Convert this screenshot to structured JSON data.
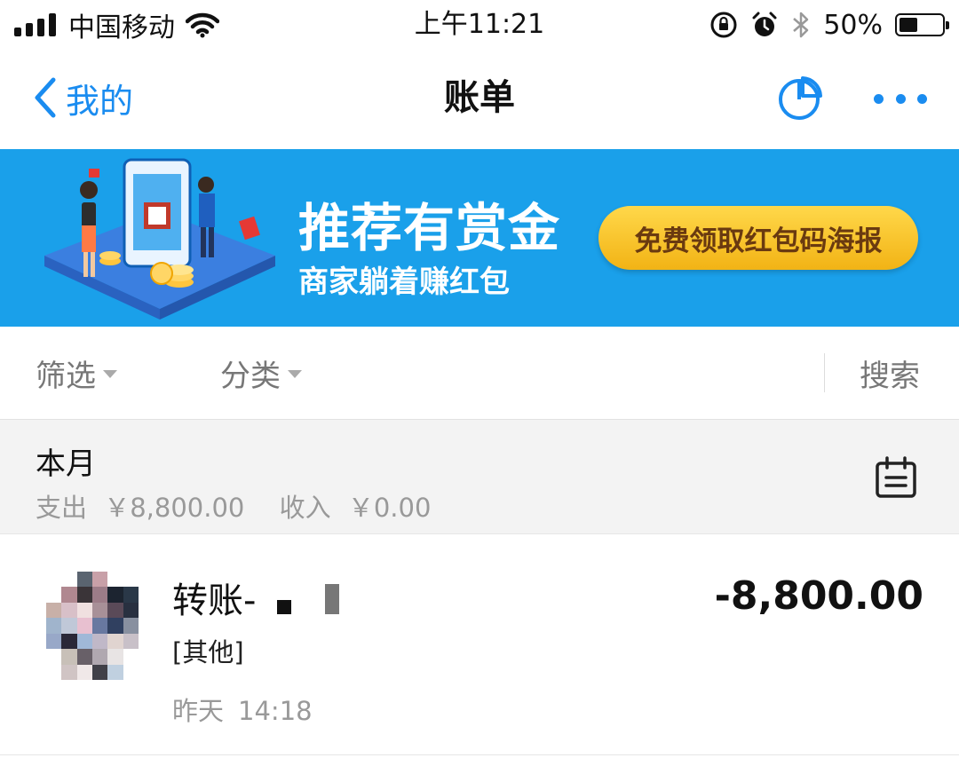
{
  "status_bar": {
    "carrier": "中国移动",
    "time": "上午11:21",
    "battery_percent": "50%",
    "battery_level": 0.5,
    "icons": [
      "signal-icon",
      "wifi-icon",
      "orientation-lock-icon",
      "alarm-icon",
      "bluetooth-icon",
      "battery-icon"
    ]
  },
  "navbar": {
    "back_label": "我的",
    "title": "账单",
    "icons": [
      "chevron-left-icon",
      "pie-chart-icon",
      "more-icon"
    ],
    "accent_color": "#1a8cf0"
  },
  "banner": {
    "title": "推荐有赏金",
    "subtitle": "商家躺着赚红包",
    "cta_label": "免费领取红包码海报",
    "background_color": "#1aa0ea"
  },
  "filter_bar": {
    "filter_label": "筛选",
    "category_label": "分类",
    "search_label": "搜索"
  },
  "month_summary": {
    "title": "本月",
    "expense_label": "支出",
    "expense_value": "￥8,800.00",
    "income_label": "收入",
    "income_value": "￥0.00",
    "icon": "calendar-icon"
  },
  "records": [
    {
      "title": "转账-",
      "category": "[其他]",
      "date": "昨天",
      "time": "14:18",
      "amount": "-8,800.00"
    }
  ]
}
